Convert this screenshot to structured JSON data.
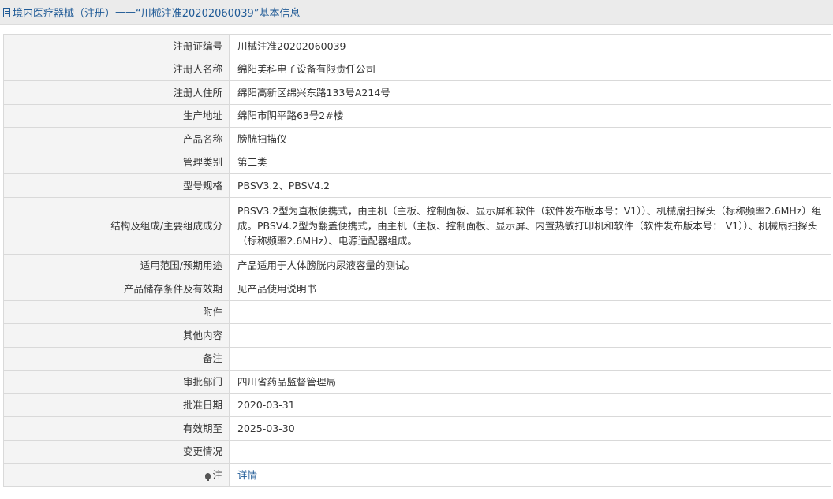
{
  "header": {
    "icon": "document-icon",
    "title": "境内医疗器械（注册）",
    "separator": " ——",
    "suffix": "“川械注准20202060039”基本信息"
  },
  "rows": [
    {
      "label": "注册证编号",
      "value": "川械注准20202060039"
    },
    {
      "label": "注册人名称",
      "value": "绵阳美科电子设备有限责任公司"
    },
    {
      "label": "注册人住所",
      "value": "绵阳高新区绵兴东路133号A214号"
    },
    {
      "label": "生产地址",
      "value": "绵阳市阴平路63号2#楼"
    },
    {
      "label": "产品名称",
      "value": "膀胱扫描仪"
    },
    {
      "label": "管理类别",
      "value": "第二类"
    },
    {
      "label": "型号规格",
      "value": "PBSV3.2、PBSV4.2"
    },
    {
      "label": "结构及组成/主要组成成分",
      "value": "PBSV3.2型为直板便携式，由主机（主板、控制面板、显示屏和软件（软件发布版本号：V1））、机械扇扫探头（标称频率2.6MHz）组成。PBSV4.2型为翻盖便携式，由主机（主板、控制面板、显示屏、内置热敏打印机和软件（软件发布版本号： V1））、机械扇扫探头（标称频率2.6MHz）、电源适配器组成。"
    },
    {
      "label": "适用范围/预期用途",
      "value": "产品适用于人体膀胱内尿液容量的测试。"
    },
    {
      "label": "产品储存条件及有效期",
      "value": "见产品使用说明书"
    },
    {
      "label": "附件",
      "value": ""
    },
    {
      "label": "其他内容",
      "value": ""
    },
    {
      "label": "备注",
      "value": ""
    },
    {
      "label": "审批部门",
      "value": "四川省药品监督管理局"
    },
    {
      "label": "批准日期",
      "value": "2020-03-31"
    },
    {
      "label": "有效期至",
      "value": "2025-03-30"
    },
    {
      "label": "变更情况",
      "value": ""
    }
  ],
  "note_row": {
    "icon": "lightbulb-icon",
    "label": "注",
    "link_text": "详情"
  }
}
